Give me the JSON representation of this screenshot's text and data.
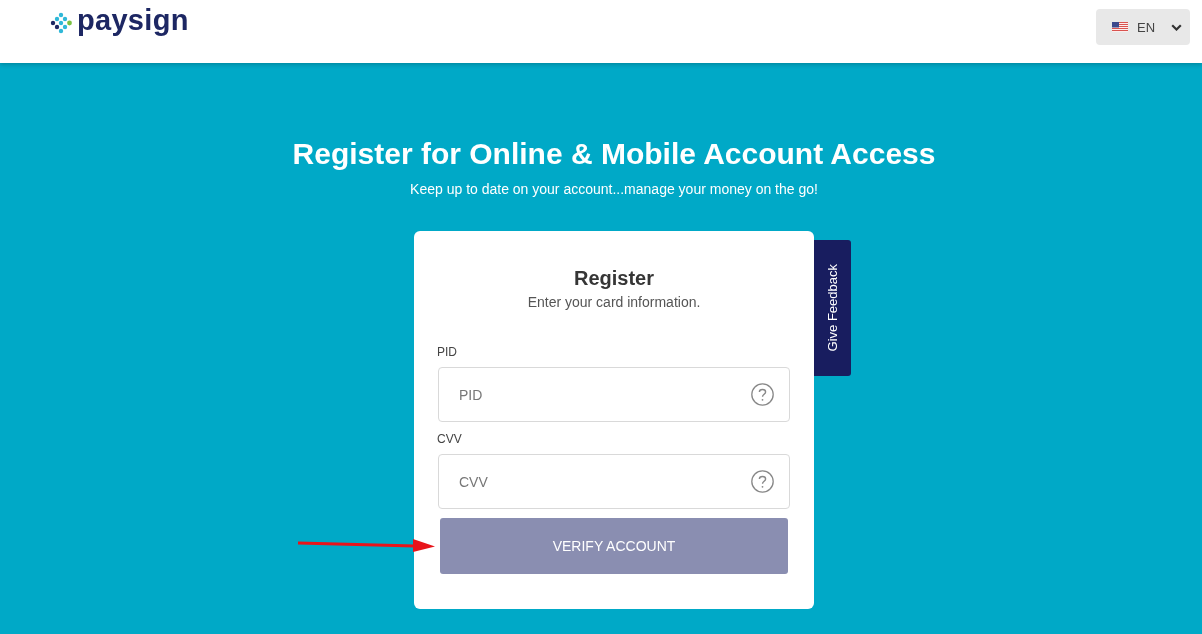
{
  "header": {
    "logo": {
      "wordmark": "paysign"
    },
    "language": {
      "code": "EN"
    }
  },
  "hero": {
    "title": "Register for Online & Mobile Account Access",
    "subtitle": "Keep up to date on your account...manage your money on the go!"
  },
  "card": {
    "title": "Register",
    "subtitle": "Enter your card information.",
    "fields": [
      {
        "label": "PID",
        "placeholder": "PID"
      },
      {
        "label": "CVV",
        "placeholder": "CVV"
      }
    ],
    "submit": {
      "label": "VERIFY ACCOUNT",
      "disabled": true
    }
  },
  "feedback_tab": {
    "label": "Give Feedback"
  },
  "annotations": [
    {
      "kind": "arrow"
    }
  ]
}
